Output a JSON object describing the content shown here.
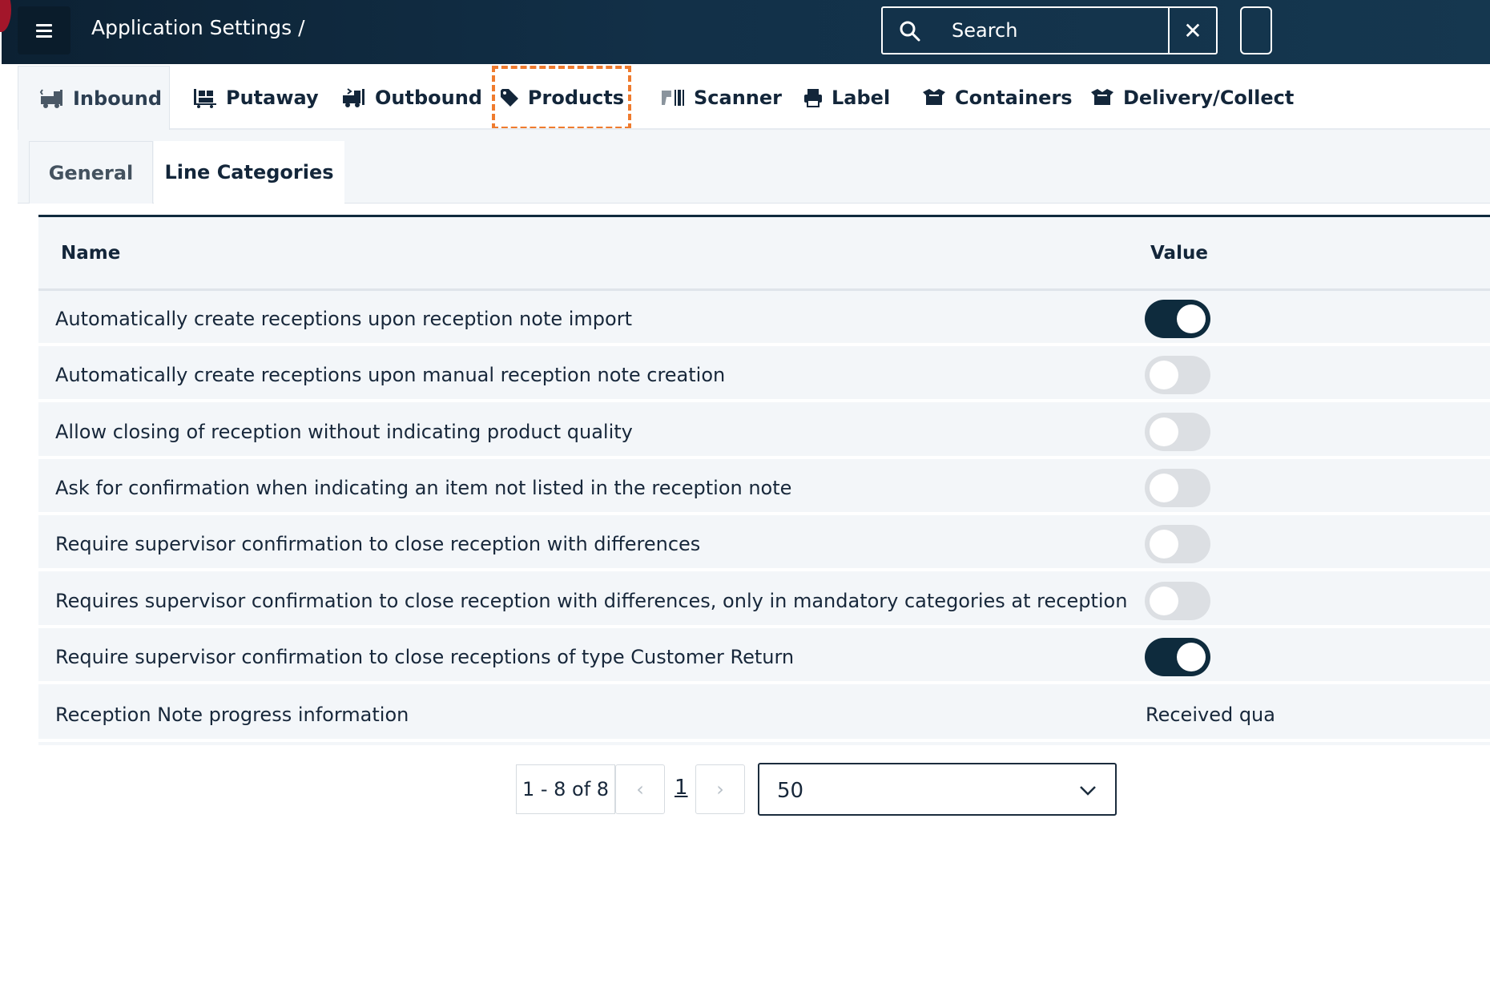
{
  "header": {
    "title": "Application Settings /",
    "search_placeholder": "Search",
    "clear_symbol": "✕"
  },
  "main_tabs": [
    {
      "label": "Inbound",
      "icon": "truck-unload-icon",
      "active": true
    },
    {
      "label": "Putaway",
      "icon": "pallet-dolly-icon"
    },
    {
      "label": "Outbound",
      "icon": "truck-load-icon"
    },
    {
      "label": "Products",
      "icon": "tags-icon",
      "highlighted": true
    },
    {
      "label": "Scanner",
      "icon": "barcode-scanner-icon"
    },
    {
      "label": "Label",
      "icon": "printer-icon"
    },
    {
      "label": "Containers",
      "icon": "open-box-icon"
    },
    {
      "label": "Delivery/Collect",
      "icon": "open-box-icon"
    }
  ],
  "sub_tabs": {
    "general": "General",
    "line_categories": "Line Categories"
  },
  "table": {
    "headers": {
      "name": "Name",
      "value": "Value"
    },
    "rows": [
      {
        "name": "Automatically create receptions upon reception note import",
        "type": "toggle",
        "on": true
      },
      {
        "name": "Automatically create receptions upon manual reception note creation",
        "type": "toggle",
        "on": false
      },
      {
        "name": "Allow closing of reception without indicating product quality",
        "type": "toggle",
        "on": false
      },
      {
        "name": "Ask for confirmation when indicating an item not listed in the reception note",
        "type": "toggle",
        "on": false
      },
      {
        "name": "Require supervisor confirmation to close reception with differences",
        "type": "toggle",
        "on": false
      },
      {
        "name": "Requires supervisor confirmation to close reception with differences, only in mandatory categories at reception",
        "type": "toggle",
        "on": false
      },
      {
        "name": "Require supervisor confirmation to close receptions of type Customer Return",
        "type": "toggle",
        "on": true
      },
      {
        "name": "Reception Note progress information",
        "type": "text",
        "value": "Received qua"
      }
    ]
  },
  "pagination": {
    "range": "1 - 8 of 8",
    "prev": "‹",
    "next": "›",
    "current_page": "1",
    "page_size": "50"
  },
  "colors": {
    "header_bg": "#0c2133",
    "toggle_on": "#0e2b3d",
    "toggle_off": "#dcdfe3",
    "highlight": "#ef7b2e"
  }
}
